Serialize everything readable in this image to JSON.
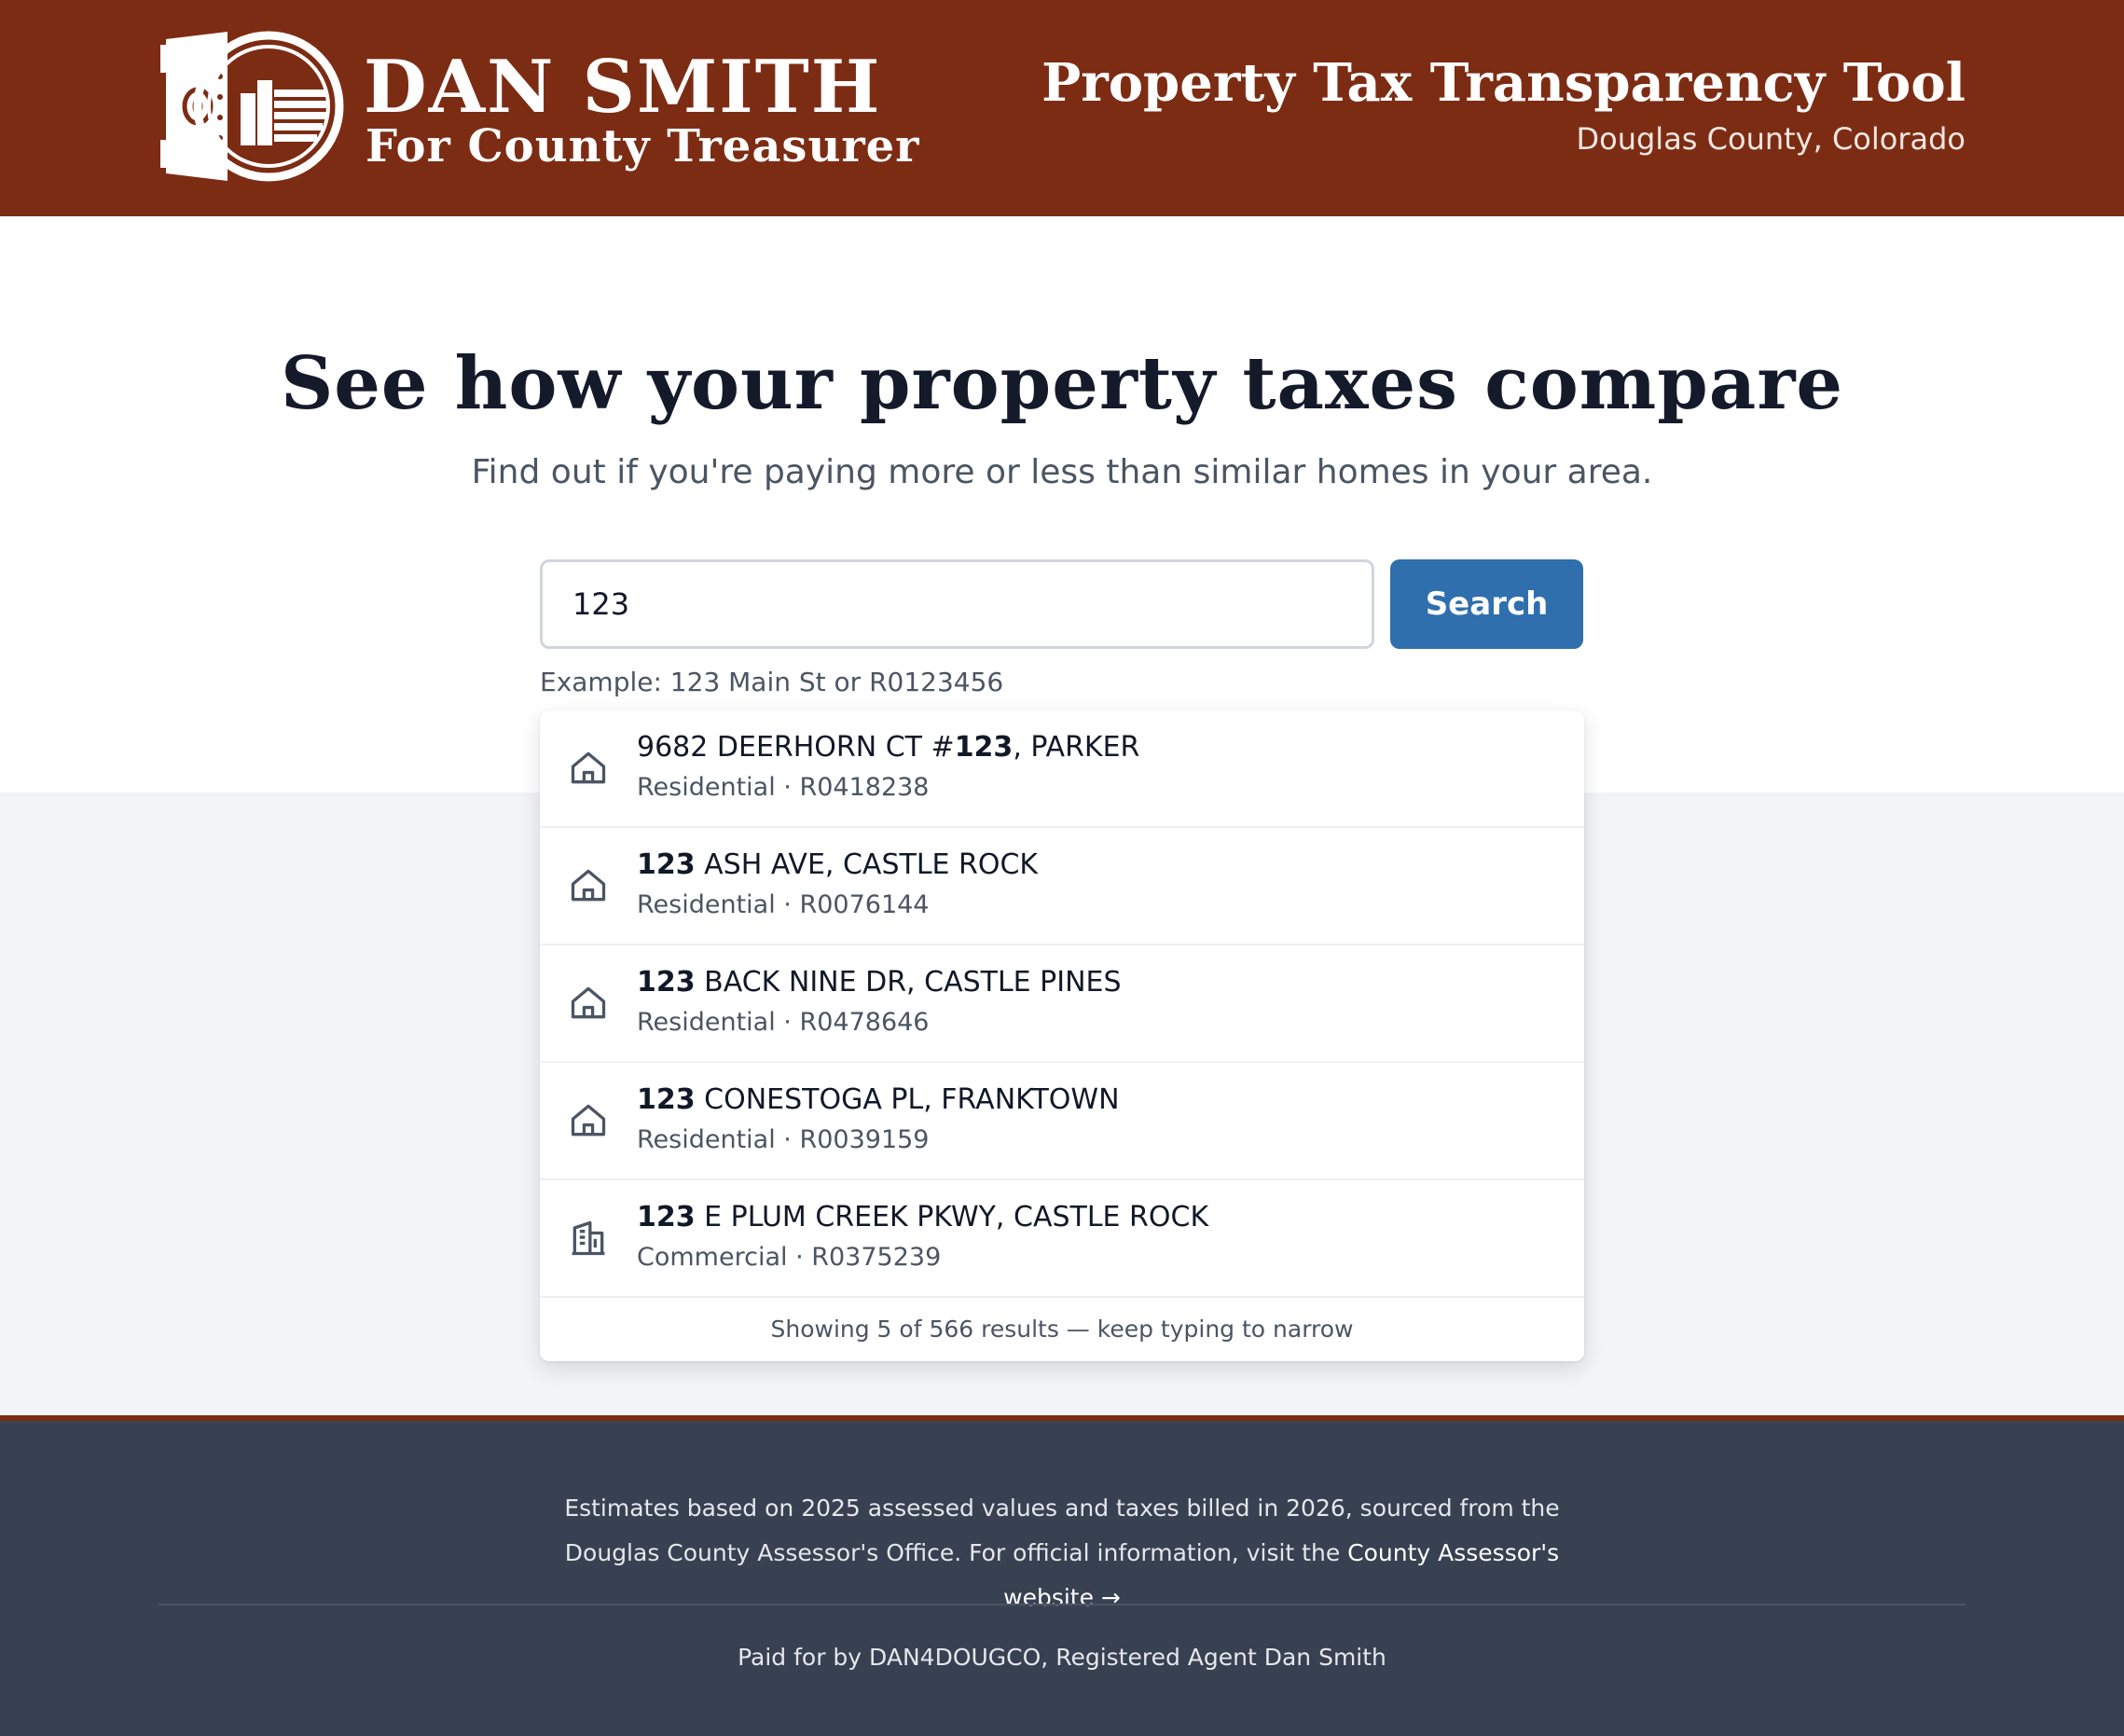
{
  "header": {
    "brand_name": "DAN SMITH",
    "brand_subtitle": "For County Treasurer",
    "logo_icon": "bank-vault-icon",
    "tool_title": "Property Tax Transparency Tool",
    "tool_subtitle": "Douglas County, Colorado"
  },
  "hero": {
    "title": "See how your property taxes compare",
    "subtitle": "Find out if you're paying more or less than similar homes in your area."
  },
  "search": {
    "value": "123",
    "button_label": "Search",
    "hint": "Example: 123 Main St or R0123456"
  },
  "results": [
    {
      "pre": "9682 DEERHORN CT #",
      "match": "123",
      "post": ", PARKER",
      "meta": "Residential · R0418238",
      "icon": "house-icon"
    },
    {
      "pre": "",
      "match": "123",
      "post": " ASH AVE, CASTLE ROCK",
      "meta": "Residential · R0076144",
      "icon": "house-icon"
    },
    {
      "pre": "",
      "match": "123",
      "post": " BACK NINE DR, CASTLE PINES",
      "meta": "Residential · R0478646",
      "icon": "house-icon"
    },
    {
      "pre": "",
      "match": "123",
      "post": " CONESTOGA PL, FRANKTOWN",
      "meta": "Residential · R0039159",
      "icon": "house-icon"
    },
    {
      "pre": "",
      "match": "123",
      "post": " E PLUM CREEK PKWY, CASTLE ROCK",
      "meta": "Commercial · R0375239",
      "icon": "office-building-icon"
    }
  ],
  "results_footer": "Showing 5 of 566 results — keep typing to narrow",
  "footer": {
    "text": "Estimates based on 2025 assessed values and taxes billed in 2026, sourced from the Douglas County Assessor's Office. For official information, visit the",
    "link_label": "County Assessor's website →",
    "paid_for": "Paid for by DAN4DOUGCO, Registered Agent Dan Smith"
  },
  "colors": {
    "brand": "#7d2c14",
    "accent": "#2f6fae",
    "footer_bg": "#374151"
  }
}
